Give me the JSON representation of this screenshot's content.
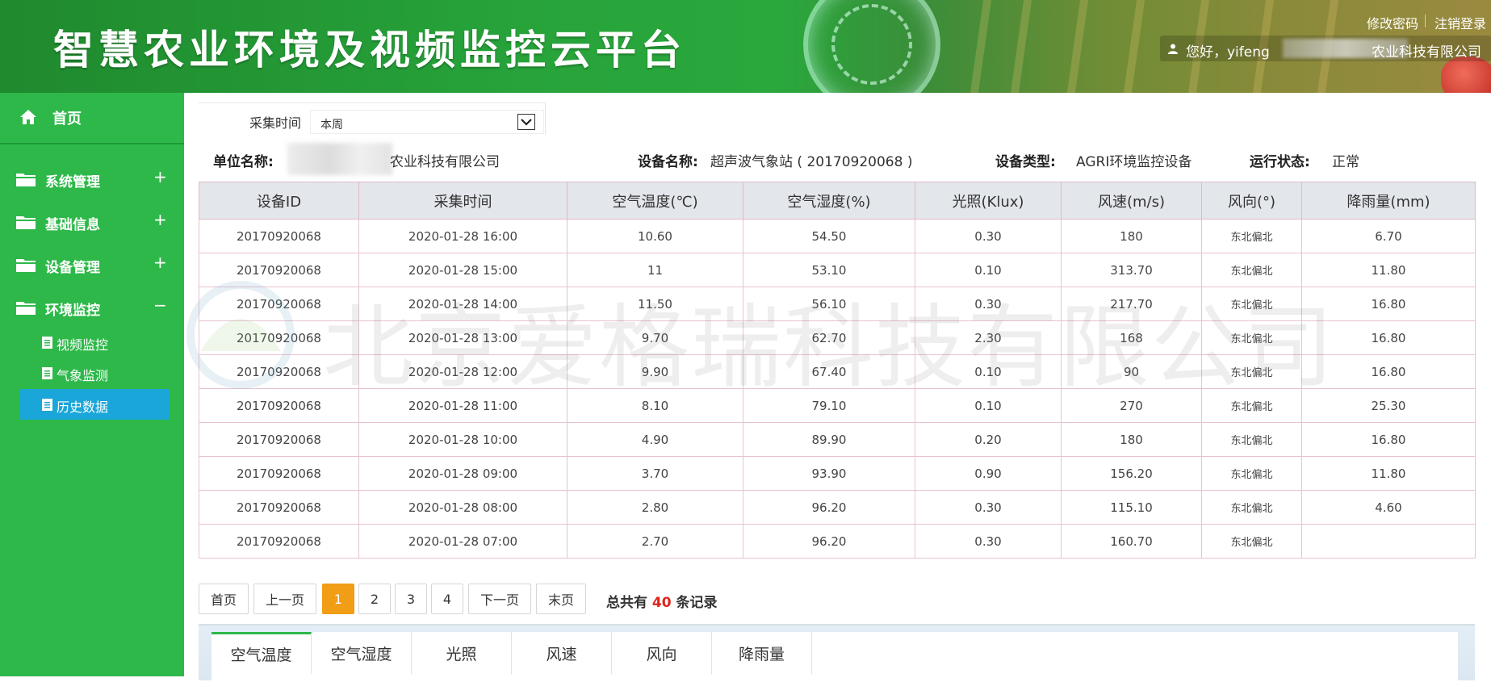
{
  "header": {
    "title": "智慧农业环境及视频监控云平台",
    "change_password": "修改密码",
    "logout": "注销登录",
    "greeting": "您好，yifeng",
    "company_suffix": "农业科技有限公司"
  },
  "sidebar": {
    "home": "首页",
    "groups": [
      {
        "label": "系统管理",
        "toggle": "+"
      },
      {
        "label": "基础信息",
        "toggle": "+"
      },
      {
        "label": "设备管理",
        "toggle": "+"
      },
      {
        "label": "环境监控",
        "toggle": "−"
      }
    ],
    "sub_items": [
      {
        "label": "视频监控"
      },
      {
        "label": "气象监测"
      },
      {
        "label": "历史数据",
        "active": true
      }
    ]
  },
  "filter": {
    "label": "采集时间",
    "value": "本周"
  },
  "info": {
    "unit_label": "单位名称:",
    "unit_value": "农业科技有限公司",
    "device_label": "设备名称:",
    "device_value": "超声波气象站 ( 20170920068 )",
    "type_label": "设备类型:",
    "type_value": "AGRI环境监控设备",
    "status_label": "运行状态:",
    "status_value": "正常"
  },
  "table": {
    "columns": [
      "设备ID",
      "采集时间",
      "空气温度(℃)",
      "空气湿度(%)",
      "光照(Klux)",
      "风速(m/s)",
      "风向(°)",
      "降雨量(mm)"
    ],
    "rows": [
      [
        "20170920068",
        "2020-01-28 16:00",
        "10.60",
        "54.50",
        "0.30",
        "180",
        "东北偏北",
        "6.70"
      ],
      [
        "20170920068",
        "2020-01-28 15:00",
        "11",
        "53.10",
        "0.10",
        "313.70",
        "东北偏北",
        "11.80"
      ],
      [
        "20170920068",
        "2020-01-28 14:00",
        "11.50",
        "56.10",
        "0.30",
        "217.70",
        "东北偏北",
        "16.80"
      ],
      [
        "20170920068",
        "2020-01-28 13:00",
        "9.70",
        "62.70",
        "2.30",
        "168",
        "东北偏北",
        "16.80"
      ],
      [
        "20170920068",
        "2020-01-28 12:00",
        "9.90",
        "67.40",
        "0.10",
        "90",
        "东北偏北",
        "16.80"
      ],
      [
        "20170920068",
        "2020-01-28 11:00",
        "8.10",
        "79.10",
        "0.10",
        "270",
        "东北偏北",
        "25.30"
      ],
      [
        "20170920068",
        "2020-01-28 10:00",
        "4.90",
        "89.90",
        "0.20",
        "180",
        "东北偏北",
        "16.80"
      ],
      [
        "20170920068",
        "2020-01-28 09:00",
        "3.70",
        "93.90",
        "0.90",
        "156.20",
        "东北偏北",
        "11.80"
      ],
      [
        "20170920068",
        "2020-01-28 08:00",
        "2.80",
        "96.20",
        "0.30",
        "115.10",
        "东北偏北",
        "4.60"
      ],
      [
        "20170920068",
        "2020-01-28 07:00",
        "2.70",
        "96.20",
        "0.30",
        "160.70",
        "东北偏北",
        ""
      ]
    ]
  },
  "watermark": "北京爱格瑞科技有限公司",
  "pager": {
    "first": "首页",
    "prev": "上一页",
    "pages": [
      "1",
      "2",
      "3",
      "4"
    ],
    "current": "1",
    "next": "下一页",
    "last": "末页",
    "total_prefix": "总共有",
    "total_count": "40",
    "total_suffix": "条记录"
  },
  "chart_tabs": [
    "空气温度",
    "空气湿度",
    "光照",
    "风速",
    "风向",
    "降雨量"
  ],
  "colors": {
    "sidebar": "#2eb84a",
    "active_sub_item": "#1aa6d8",
    "pager_active": "#f29d16",
    "total_count": "#e0241b"
  }
}
